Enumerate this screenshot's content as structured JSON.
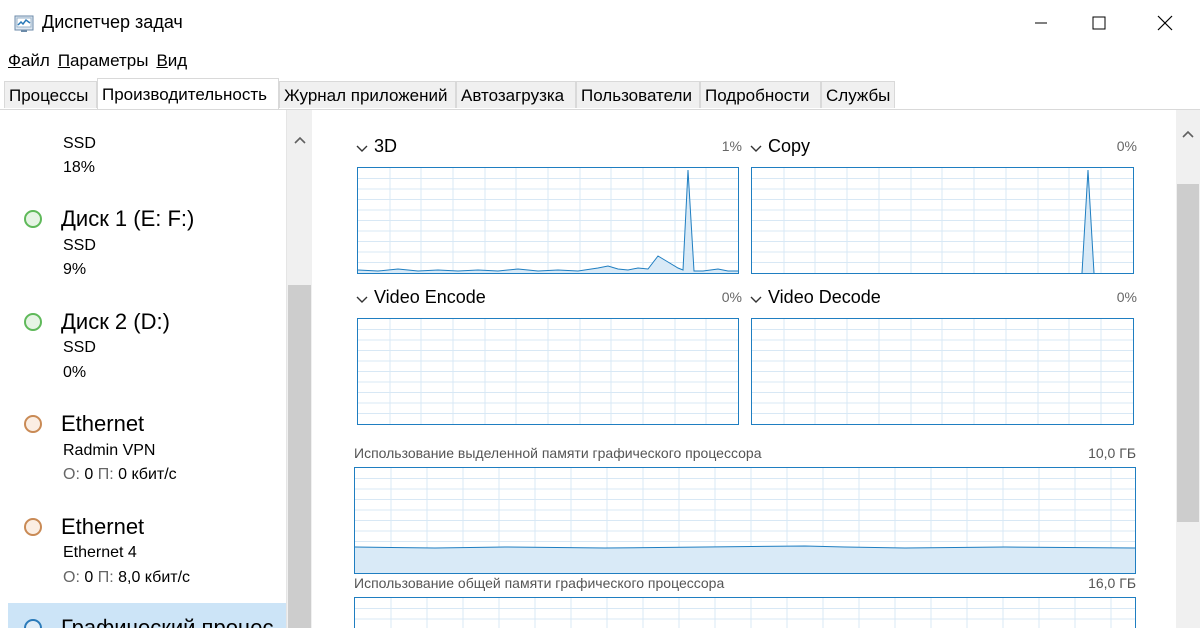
{
  "window": {
    "title": "Диспетчер задач"
  },
  "menu": [
    {
      "first": "Ф",
      "rest": "айл"
    },
    {
      "first": "П",
      "rest": "араметры"
    },
    {
      "first": "В",
      "rest": "ид"
    }
  ],
  "tabs": [
    "Процессы",
    "Производительность",
    "Журнал приложений",
    "Автозагрузка",
    "Пользователи",
    "Подробности",
    "Службы"
  ],
  "active_tab": "Производительность",
  "sidebar": {
    "partial_top": {
      "sub": "SSD",
      "value": "18%"
    },
    "items": [
      {
        "name": "Диск 1 (E: F:)",
        "sub": "SSD",
        "value": "9%",
        "status": "green"
      },
      {
        "name": "Диск 2 (D:)",
        "sub": "SSD",
        "value": "0%",
        "status": "green"
      },
      {
        "name": "Ethernet",
        "sub": "Radmin VPN",
        "send_label": "О:",
        "send": "0",
        "recv_label": "П:",
        "recv": "0 кбит/с",
        "status": "orange"
      },
      {
        "name": "Ethernet",
        "sub": "Ethernet 4",
        "send_label": "О:",
        "send": "0",
        "recv_label": "П:",
        "recv": "8,0 кбит/с",
        "status": "orange"
      },
      {
        "name": "Графический процес",
        "status": "blue"
      }
    ]
  },
  "gpu_engines": [
    {
      "name": "3D",
      "value": "1%"
    },
    {
      "name": "Copy",
      "value": "0%"
    },
    {
      "name": "Video Encode",
      "value": "0%"
    },
    {
      "name": "Video Decode",
      "value": "0%"
    }
  ],
  "memory": {
    "dedicated_label": "Использование выделенной памяти графического процессора",
    "dedicated_max": "10,0 ГБ",
    "shared_label": "Использование общей памяти графического процессора",
    "shared_max": "16,0 ГБ"
  },
  "colors": {
    "graph_border": "#1f7ec1",
    "grid": "#d8e8f5",
    "selected": "#cce4f7"
  }
}
